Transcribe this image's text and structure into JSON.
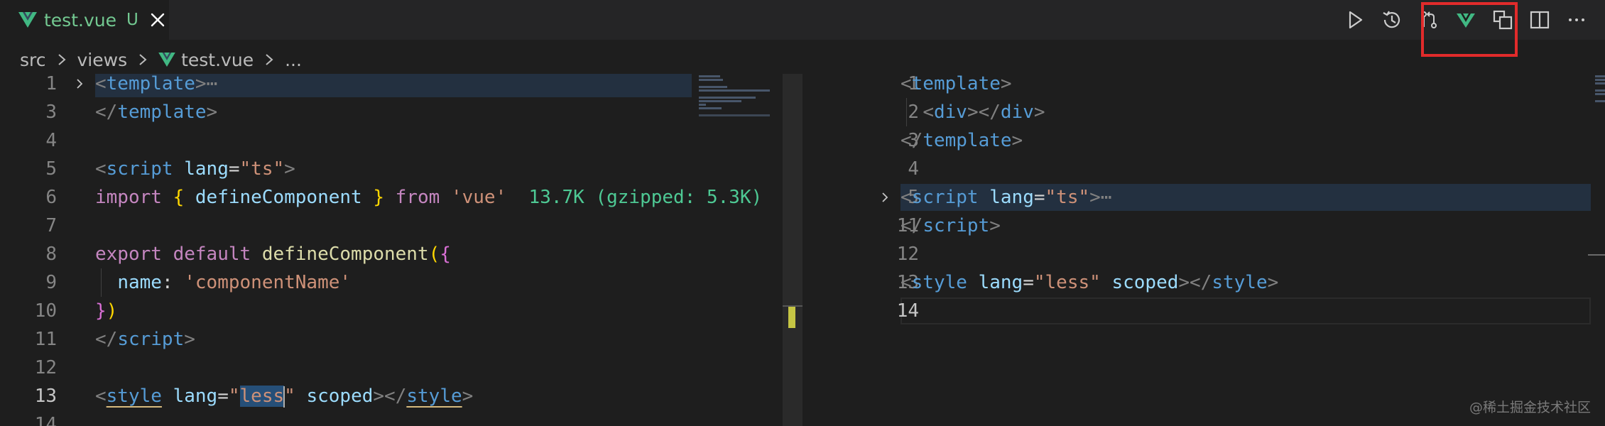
{
  "tab": {
    "filename": "test.vue",
    "status": "U"
  },
  "breadcrumb": {
    "folder1": "src",
    "folder2": "views",
    "file": "test.vue",
    "more": "..."
  },
  "actions": [
    {
      "icon": "play-icon"
    },
    {
      "icon": "history-icon"
    },
    {
      "icon": "git-compare-icon"
    },
    {
      "icon": "vue-split-icon"
    },
    {
      "icon": "open-preview-icon"
    },
    {
      "icon": "split-editor-icon"
    },
    {
      "icon": "more-actions-icon"
    }
  ],
  "colors": {
    "tab_text": "#73c991",
    "vue_green": "#41b883",
    "highlight_box": "#e12b2b"
  },
  "left_editor": {
    "lines": [
      {
        "num": "1",
        "fold": true,
        "highlight": true,
        "tokens": [
          [
            "t-punc",
            "<"
          ],
          [
            "t-tag",
            "template"
          ],
          [
            "t-punc",
            ">"
          ],
          [
            "t-fold",
            "⋯"
          ]
        ]
      },
      {
        "num": "3",
        "tokens": [
          [
            "t-punc",
            "</"
          ],
          [
            "t-tag",
            "template"
          ],
          [
            "t-punc",
            ">"
          ]
        ]
      },
      {
        "num": "4",
        "tokens": []
      },
      {
        "num": "5",
        "tokens": [
          [
            "t-punc",
            "<"
          ],
          [
            "t-tag",
            "script"
          ],
          [
            "t-plain",
            " "
          ],
          [
            "t-attr",
            "lang"
          ],
          [
            "t-plain",
            "="
          ],
          [
            "t-str",
            "\"ts\""
          ],
          [
            "t-punc",
            ">"
          ]
        ]
      },
      {
        "num": "6",
        "tokens": [
          [
            "t-kw",
            "import"
          ],
          [
            "t-plain",
            " "
          ],
          [
            "t-br1",
            "{"
          ],
          [
            "t-plain",
            " "
          ],
          [
            "t-var",
            "defineComponent"
          ],
          [
            "t-plain",
            " "
          ],
          [
            "t-br1",
            "}"
          ],
          [
            "t-plain",
            " "
          ],
          [
            "t-kw",
            "from"
          ],
          [
            "t-plain",
            " "
          ],
          [
            "t-str",
            "'vue'"
          ],
          [
            "t-plain",
            "  "
          ],
          [
            "t-inlay",
            "13.7K (gzipped: 5.3K)"
          ]
        ]
      },
      {
        "num": "7",
        "tokens": []
      },
      {
        "num": "8",
        "tokens": [
          [
            "t-kw",
            "export"
          ],
          [
            "t-plain",
            " "
          ],
          [
            "t-kw",
            "default"
          ],
          [
            "t-plain",
            " "
          ],
          [
            "t-fn",
            "defineComponent"
          ],
          [
            "t-br1",
            "("
          ],
          [
            "t-br2",
            "{"
          ]
        ]
      },
      {
        "num": "9",
        "guide": true,
        "tokens": [
          [
            "t-plain",
            "  "
          ],
          [
            "t-var",
            "name"
          ],
          [
            "t-plain",
            ": "
          ],
          [
            "t-str",
            "'componentName'"
          ]
        ]
      },
      {
        "num": "10",
        "tokens": [
          [
            "t-br2",
            "}"
          ],
          [
            "t-br1",
            ")"
          ]
        ]
      },
      {
        "num": "11",
        "tokens": [
          [
            "t-punc",
            "</"
          ],
          [
            "t-tag",
            "script"
          ],
          [
            "t-punc",
            ">"
          ]
        ]
      },
      {
        "num": "12",
        "tokens": []
      },
      {
        "num": "13",
        "active": true,
        "tokens": [
          [
            "t-punc",
            "<"
          ],
          [
            "t-tag t-underline",
            "style"
          ],
          [
            "t-plain",
            " "
          ],
          [
            "t-attr",
            "lang"
          ],
          [
            "t-plain",
            "="
          ],
          [
            "t-str",
            "\""
          ],
          [
            "t-str t-sel",
            "less"
          ],
          [
            "caret",
            ""
          ],
          [
            "t-str",
            "\""
          ],
          [
            "t-plain",
            " "
          ],
          [
            "t-attr",
            "scoped"
          ],
          [
            "t-punc",
            "></"
          ],
          [
            "t-tag t-underline",
            "style"
          ],
          [
            "t-punc",
            ">"
          ]
        ]
      },
      {
        "num": "14",
        "tokens": []
      }
    ]
  },
  "right_editor": {
    "lines": [
      {
        "num": "1",
        "tokens": [
          [
            "t-punc",
            "<"
          ],
          [
            "t-tag",
            "template"
          ],
          [
            "t-punc",
            ">"
          ]
        ]
      },
      {
        "num": "2",
        "guide": true,
        "tokens": [
          [
            "t-plain",
            "  "
          ],
          [
            "t-punc",
            "<"
          ],
          [
            "t-tag",
            "div"
          ],
          [
            "t-punc",
            "></"
          ],
          [
            "t-tag",
            "div"
          ],
          [
            "t-punc",
            ">"
          ]
        ]
      },
      {
        "num": "3",
        "tokens": [
          [
            "t-punc",
            "</"
          ],
          [
            "t-tag",
            "template"
          ],
          [
            "t-punc",
            ">"
          ]
        ]
      },
      {
        "num": "4",
        "tokens": []
      },
      {
        "num": "5",
        "fold": true,
        "highlight": true,
        "tokens": [
          [
            "t-punc",
            "<"
          ],
          [
            "t-tag",
            "script"
          ],
          [
            "t-plain",
            " "
          ],
          [
            "t-attr",
            "lang"
          ],
          [
            "t-plain",
            "="
          ],
          [
            "t-str",
            "\"ts\""
          ],
          [
            "t-punc",
            ">"
          ],
          [
            "t-fold",
            "⋯"
          ]
        ]
      },
      {
        "num": "11",
        "tokens": [
          [
            "t-punc",
            "</"
          ],
          [
            "t-tag",
            "script"
          ],
          [
            "t-punc",
            ">"
          ]
        ]
      },
      {
        "num": "12",
        "tokens": []
      },
      {
        "num": "13",
        "tokens": [
          [
            "t-punc",
            "<"
          ],
          [
            "t-tag",
            "style"
          ],
          [
            "t-plain",
            " "
          ],
          [
            "t-attr",
            "lang"
          ],
          [
            "t-plain",
            "="
          ],
          [
            "t-str",
            "\"less\""
          ],
          [
            "t-plain",
            " "
          ],
          [
            "t-attr",
            "scoped"
          ],
          [
            "t-punc",
            "></"
          ],
          [
            "t-tag",
            "style"
          ],
          [
            "t-punc",
            ">"
          ]
        ]
      },
      {
        "num": "14",
        "active": true,
        "cursor_line": true,
        "tokens": []
      }
    ]
  },
  "watermark": "@稀土掘金技术社区"
}
